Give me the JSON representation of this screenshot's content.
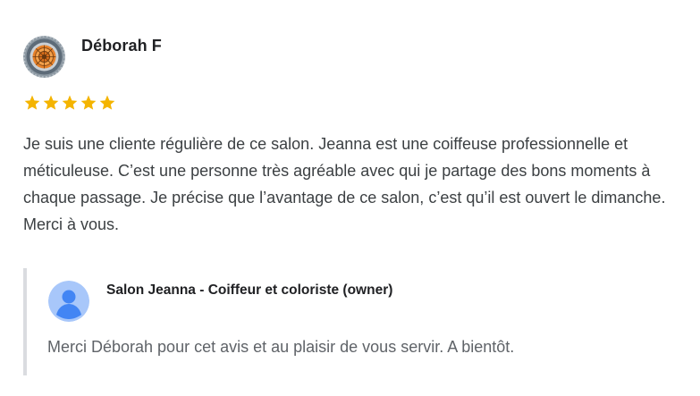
{
  "review": {
    "reviewer_name": "Déborah F",
    "rating": 5,
    "star_color": "#f4b400",
    "text": "Je suis une cliente régulière de ce salon. Jeanna est une coiffeuse professionnelle et méticuleuse. C’est une personne très agréable avec qui je partage des bons moments à chaque passage. Je précise que l’avantage de ce salon, c’est qu’il est ouvert le dimanche. Merci à vous."
  },
  "owner_reply": {
    "owner_name": "Salon Jeanna - Coiffeur et coloriste (owner)",
    "text": "Merci Déborah pour cet avis et au plaisir de vous servir. A bientôt.",
    "avatar_color": "#4285f4"
  }
}
